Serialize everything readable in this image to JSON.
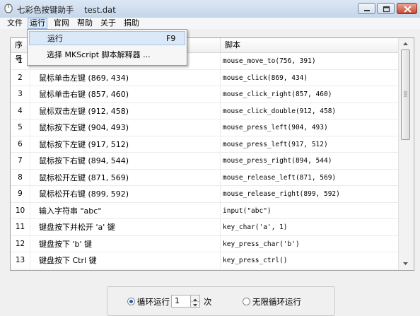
{
  "window": {
    "app_name": "七彩色按键助手",
    "file_name": "test.dat"
  },
  "menu": {
    "items": [
      "文件",
      "运行",
      "官网",
      "帮助",
      "关于",
      "捐助"
    ],
    "active": "运行"
  },
  "run_menu": {
    "items": [
      {
        "label": "运行",
        "shortcut": "F9"
      },
      {
        "label": "选择 MKScript 脚本解释器 ...",
        "shortcut": ""
      }
    ]
  },
  "table": {
    "headers": {
      "num": "序号",
      "action": "",
      "script": "脚本"
    },
    "rows": [
      {
        "num": "1",
        "action": "",
        "script": "mouse_move_to(756, 391)"
      },
      {
        "num": "2",
        "action": "鼠标单击左键 (869, 434)",
        "script": "mouse_click(869, 434)"
      },
      {
        "num": "3",
        "action": "鼠标单击右键 (857, 460)",
        "script": "mouse_click_right(857, 460)"
      },
      {
        "num": "4",
        "action": "鼠标双击左键 (912, 458)",
        "script": "mouse_click_double(912, 458)"
      },
      {
        "num": "5",
        "action": "鼠标按下左键 (904, 493)",
        "script": "mouse_press_left(904, 493)"
      },
      {
        "num": "6",
        "action": "鼠标按下左键 (917, 512)",
        "script": "mouse_press_left(917, 512)"
      },
      {
        "num": "7",
        "action": "鼠标按下右键 (894, 544)",
        "script": "mouse_press_right(894, 544)"
      },
      {
        "num": "8",
        "action": "鼠标松开左键 (871, 569)",
        "script": "mouse_release_left(871, 569)"
      },
      {
        "num": "9",
        "action": "鼠标松开右键 (899, 592)",
        "script": "mouse_release_right(899, 592)"
      },
      {
        "num": "10",
        "action": "输入字符串 \"abc\"",
        "script": "input(\"abc\")"
      },
      {
        "num": "11",
        "action": "键盘按下并松开 'a' 键",
        "script": "key_char('a', 1)"
      },
      {
        "num": "12",
        "action": "键盘按下 'b' 键",
        "script": "key_press_char('b')"
      },
      {
        "num": "13",
        "action": "键盘按下 Ctrl 键",
        "script": "key_press_ctrl()"
      }
    ]
  },
  "options": {
    "loop_label": "循环运行",
    "loop_count": "1",
    "times_unit": "次",
    "infinite_label": "无限循环运行",
    "selected": "loop"
  },
  "colors": {
    "menu_active_bg": "#dce9f7",
    "close_button": "#c9462c",
    "radio_selected": "#1f5fa8"
  }
}
